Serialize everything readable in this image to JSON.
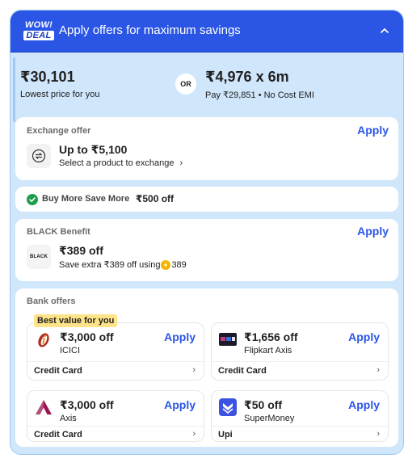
{
  "header": {
    "logo_line1": "WOW!",
    "logo_line2": "DEAL",
    "title": "Apply offers for maximum savings"
  },
  "pricing": {
    "lowest_price": "₹30,101",
    "lowest_label": "Lowest price for you",
    "or_label": "OR",
    "emi_price": "₹4,976 x 6m",
    "emi_label": "Pay ₹29,851 • No Cost EMI"
  },
  "exchange": {
    "title": "Exchange offer",
    "apply": "Apply",
    "amount": "Up to ₹5,100",
    "subtitle": "Select a product to exchange",
    "chevron": "›"
  },
  "buy_more": {
    "label": "Buy More Save More",
    "amount": "₹500 off"
  },
  "black": {
    "title": "BLACK Benefit",
    "apply": "Apply",
    "logo_text": "BLACK",
    "amount": "₹389 off",
    "subtitle_prefix": "Save extra ₹389 off using",
    "coin_value": "389"
  },
  "bank_offers": {
    "title": "Bank offers",
    "best_badge": "Best value for you",
    "cards": [
      {
        "amount": "₹3,000 off",
        "bank": "ICICI",
        "apply": "Apply",
        "type": "Credit Card",
        "icon": "icici-logo-icon",
        "chevron": "›"
      },
      {
        "amount": "₹1,656 off",
        "bank": "Flipkart Axis",
        "apply": "Apply",
        "type": "Credit Card",
        "icon": "flipkart-axis-card-icon",
        "chevron": "›"
      },
      {
        "amount": "₹3,000 off",
        "bank": "Axis",
        "apply": "Apply",
        "type": "Credit Card",
        "icon": "axis-logo-icon",
        "chevron": "›"
      },
      {
        "amount": "₹50 off",
        "bank": "SuperMoney",
        "apply": "Apply",
        "type": "Upi",
        "icon": "supermoney-logo-icon",
        "chevron": "›"
      }
    ]
  },
  "colors": {
    "header_blue": "#2a55e5",
    "panel_bg": "#cfe6fb",
    "apply_blue": "#2a55e5",
    "success_green": "#1f9d4d",
    "badge_yellow": "#ffe38a"
  }
}
